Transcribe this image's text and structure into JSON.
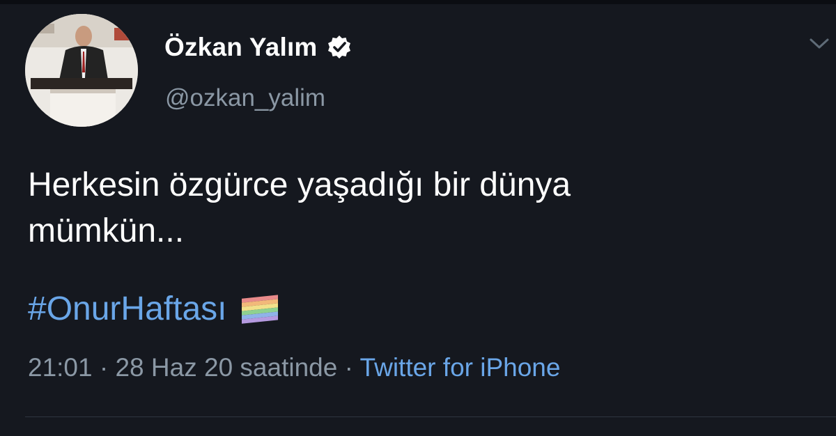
{
  "tweet": {
    "display_name": "Özkan Yalım",
    "verified_icon": "verified-badge-icon",
    "handle": "@ozkan_yalim",
    "text_line1": "Herkesin özgürce yaşadığı bir dünya",
    "text_line2": "mümkün...",
    "hashtag": "#OnurHaftası",
    "emoji": "rainbow-flag-icon",
    "time": "21:01",
    "separator": "·",
    "date": "28 Haz 20 saatinde",
    "source": "Twitter for iPhone"
  },
  "colors": {
    "background": "#15181f",
    "primary_text": "#ffffff",
    "secondary_text": "#8b98a5",
    "link": "#6aa6e8"
  }
}
